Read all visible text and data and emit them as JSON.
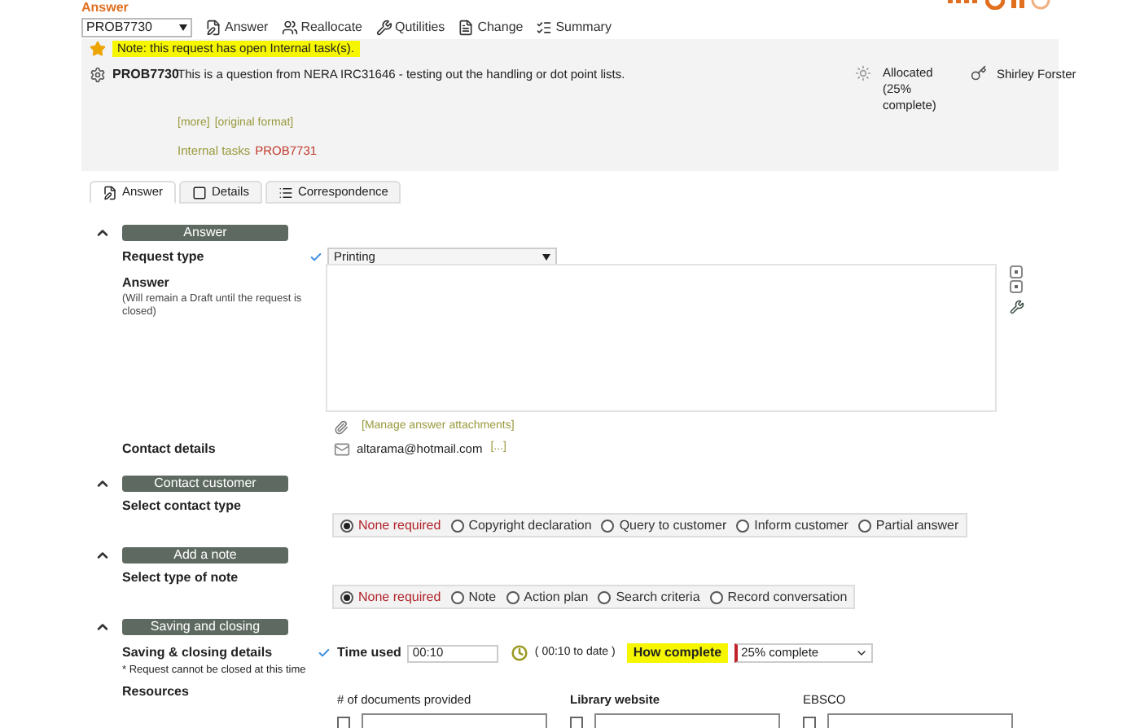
{
  "header": {
    "title": "Answer"
  },
  "toolbar": {
    "request": "PROB7730",
    "buttons": [
      {
        "kind": "answer",
        "label": "Answer"
      },
      {
        "kind": "reallocate",
        "label": "Reallocate"
      },
      {
        "kind": "utilities",
        "label": "Qutilities"
      },
      {
        "kind": "change",
        "label": "Change"
      },
      {
        "kind": "summary",
        "label": "Summary"
      }
    ]
  },
  "note": "Note: this request has open Internal task(s).",
  "request": {
    "id": "PROB7730",
    "description": "This is a question from NERA IRC31646 - testing out the handling or dot point lists.",
    "status": "Allocated (25% complete)",
    "assignee": "Shirley Forster",
    "links": [
      "[more]",
      "[original format]"
    ],
    "internal_tasks_label": "Internal tasks",
    "internal_task": "PROB7731"
  },
  "tabs": [
    {
      "kind": "answer",
      "label": "Answer",
      "selected": true
    },
    {
      "kind": "details",
      "label": "Details",
      "selected": false
    },
    {
      "kind": "correspondence",
      "label": "Correspondence",
      "selected": false
    }
  ],
  "answer_section": {
    "title": "Answer",
    "expanded": true,
    "request_type_label": "Request type",
    "request_type": "Printing",
    "request_type_valid": true,
    "answer_label": "Answer",
    "answer_hint": "(Will remain a Draft until the request is closed)",
    "attachments_link": "[Manage answer attachments]",
    "contact_label": "Contact details",
    "email": "altarama@hotmail.com",
    "email_more": "[...]"
  },
  "contact_section": {
    "title": "Contact customer",
    "expanded": true,
    "label": "Select contact type",
    "options": [
      {
        "label": "None required",
        "selected": true
      },
      {
        "label": "Copyright declaration",
        "selected": false
      },
      {
        "label": "Query to customer",
        "selected": false
      },
      {
        "label": "Inform customer",
        "selected": false
      },
      {
        "label": "Partial answer",
        "selected": false
      }
    ]
  },
  "note_section": {
    "title": "Add a note",
    "expanded": true,
    "label": "Select type of note",
    "options": [
      {
        "label": "None required",
        "selected": true
      },
      {
        "label": "Note",
        "selected": false
      },
      {
        "label": "Action plan",
        "selected": false
      },
      {
        "label": "Search criteria",
        "selected": false
      },
      {
        "label": "Record conversation",
        "selected": false
      }
    ]
  },
  "saving_section": {
    "title": "Saving and closing",
    "expanded": true,
    "label": "Saving & closing details",
    "hint": "* Request cannot be closed at this time",
    "time_used_label": "Time used",
    "time_used_valid": true,
    "time_used": "00:10",
    "to_date": "( 00:10 to date )",
    "how_complete_label": "How complete",
    "how_complete": "25% complete",
    "resources_label": "Resources",
    "resources": [
      {
        "label": "# of documents provided",
        "bold": false,
        "checked": false
      },
      {
        "label": "Library website",
        "bold": true,
        "checked": false
      },
      {
        "label": "EBSCO",
        "bold": false,
        "checked": false
      }
    ]
  }
}
